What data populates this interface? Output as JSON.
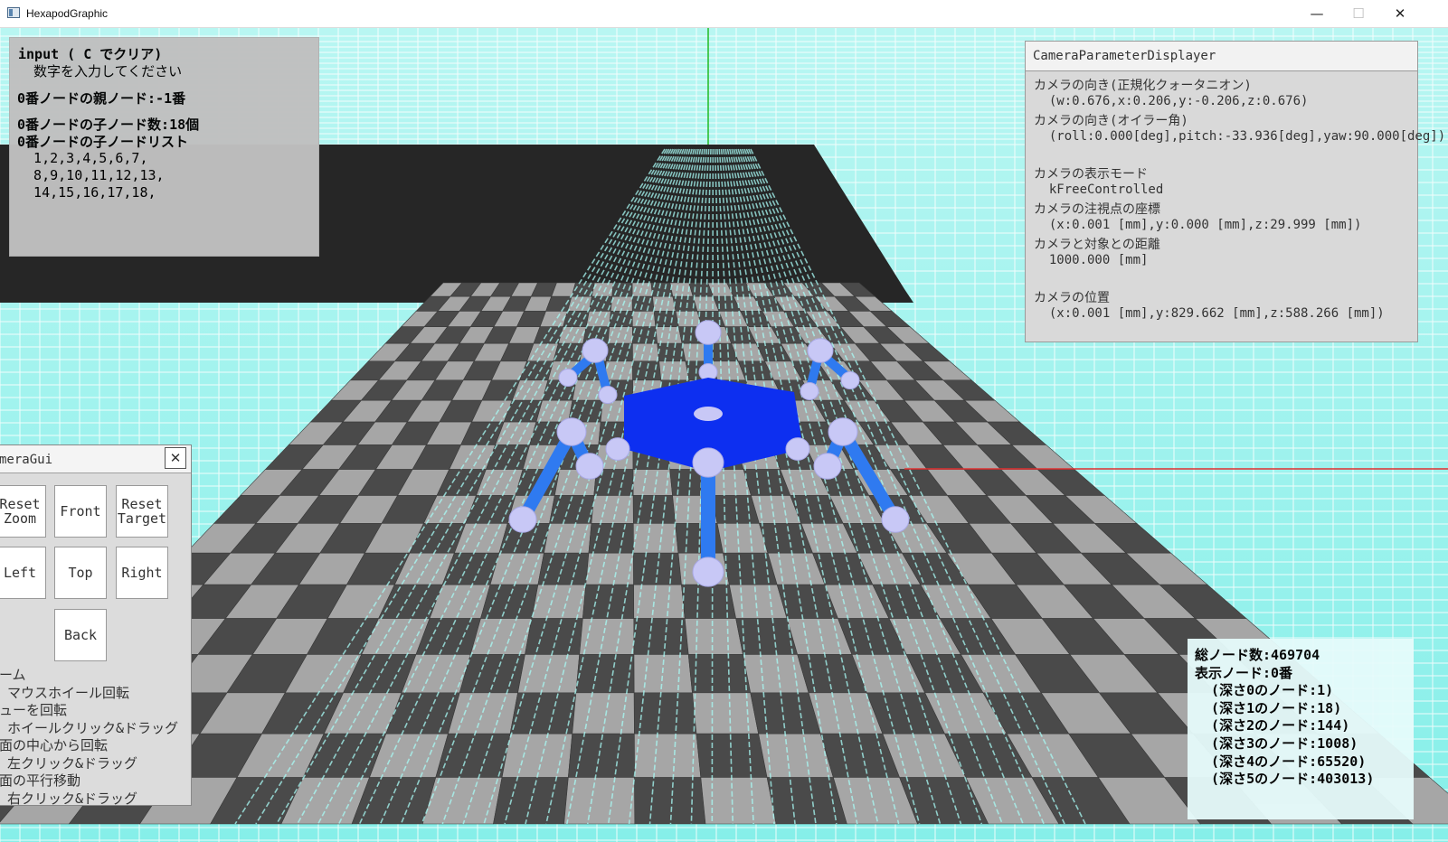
{
  "window": {
    "title": "HexapodGraphic",
    "minimize": "—",
    "maximize": "☐",
    "close": "✕"
  },
  "input_panel": {
    "line1": "input ( C でクリア)",
    "line2": "  数字を入力してください",
    "line3": "0番ノードの親ノード:-1番",
    "line4": "0番ノードの子ノード数:18個",
    "line5": "0番ノードの子ノードリスト",
    "line6": "  1,2,3,4,5,6,7,",
    "line7": "  8,9,10,11,12,13,",
    "line8": "  14,15,16,17,18,"
  },
  "camera_panel": {
    "title": "CameraParameterDisplayer",
    "lines": [
      "カメラの向き(正規化クォータニオン)",
      "  (w:0.676,x:0.206,y:-0.206,z:0.676)",
      "カメラの向き(オイラー角)",
      "  (roll:0.000[deg],pitch:-33.936[deg],yaw:90.000[deg])",
      "",
      "カメラの表示モード",
      "  kFreeControlled",
      "カメラの注視点の座標",
      "  (x:0.001 [mm],y:0.000 [mm],z:29.999 [mm])",
      "カメラと対象との距離",
      "  1000.000 [mm]",
      "",
      "カメラの位置",
      "  (x:0.001 [mm],y:829.662 [mm],z:588.266 [mm])"
    ]
  },
  "camera_gui": {
    "title": "meraGui",
    "close": "✕",
    "buttons": {
      "reset_zoom": "Reset\nZoom",
      "front": "Front",
      "reset_target": "Reset\nTarget",
      "left": "Left",
      "top": "Top",
      "right": "Right",
      "back": "Back"
    },
    "help": [
      "ーム",
      " マウスホイール回転",
      "ューを回転",
      " ホイールクリック&ドラッグ",
      "面の中心から回転",
      " 左クリック&ドラッグ",
      "面の平行移動",
      " 右クリック&ドラッグ"
    ]
  },
  "node_panel": {
    "lines": [
      "総ノード数:469704",
      "表示ノード:0番",
      "  (深さ0のノード:1)",
      "  (深さ1のノード:18)",
      "  (深さ2のノード:144)",
      "  (深さ3のノード:1008)",
      "  (深さ4のノード:65520)",
      "  (深さ5のノード:403013)"
    ]
  },
  "colors": {
    "sky": "#9ff3ee",
    "grid_line": "#ffffff",
    "dark_plane": "#262626",
    "tile_light": "#a6a6a6",
    "tile_dark": "#4a4a4a",
    "robot_body": "#0d2ff0",
    "robot_leg": "#2f7af0",
    "robot_joint": "#c8c8f6",
    "axis_green": "#22bb22",
    "axis_red": "#e03030"
  }
}
